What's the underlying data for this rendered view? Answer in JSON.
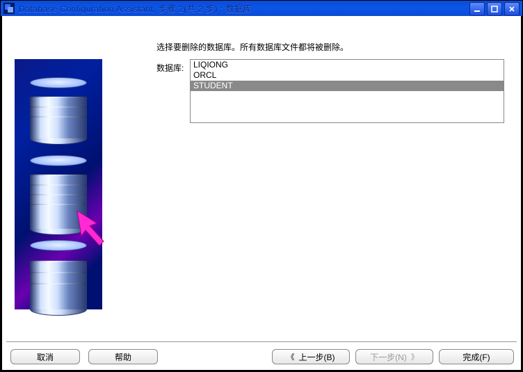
{
  "window": {
    "title": "Database Configuration Assistant, 步骤 2(共 2 步) : 数据库"
  },
  "instruction": "选择要删除的数据库。所有数据库文件都将被删除。",
  "db_label": "数据库:",
  "databases": {
    "items": [
      "LIQIONG",
      "ORCL",
      "STUDENT"
    ],
    "selected_index": 2
  },
  "buttons": {
    "cancel": "取消",
    "help": "帮助",
    "back": "上一步(B)",
    "next": "下一步(N)",
    "finish": "完成(F)",
    "back_chevron": "《",
    "next_chevron": "》"
  },
  "nav_state": {
    "back_enabled": true,
    "next_enabled": false,
    "finish_enabled": true
  }
}
